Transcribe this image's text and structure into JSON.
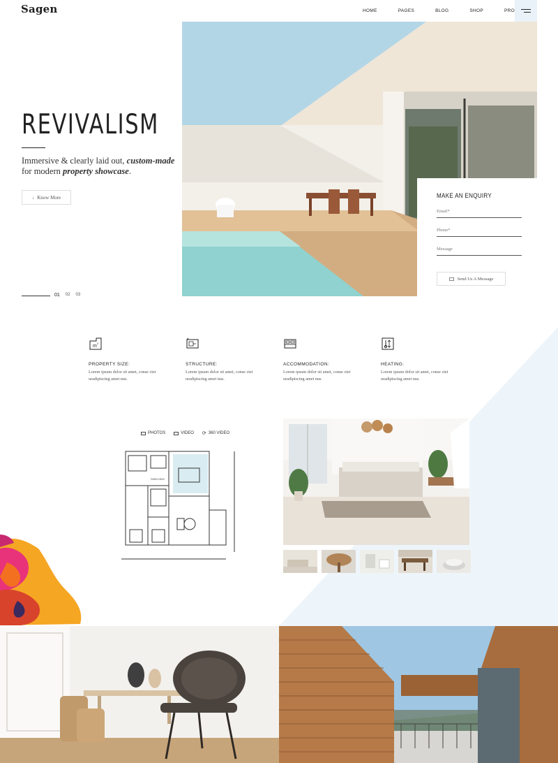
{
  "header": {
    "logo": "Sagen",
    "nav": [
      "HOME",
      "PAGES",
      "BLOG",
      "SHOP",
      "PROPERTY"
    ],
    "menu_icon": "hamburger-icon"
  },
  "hero": {
    "title": "REVIVALISM",
    "subtitle_part1": "Immersive & clearly laid out, ",
    "subtitle_em1": "custom-made",
    "subtitle_part2": " for modern ",
    "subtitle_em2": "property showcase",
    "subtitle_part3": ".",
    "button": "Know More",
    "slides": [
      "01",
      "02",
      "03"
    ],
    "active_slide": "01"
  },
  "enquiry": {
    "title": "MAKE AN ENQUIRY",
    "fields": [
      "Email*",
      "Phone*",
      "Message"
    ],
    "button": "Send Us A Message"
  },
  "features": [
    {
      "title": "PROPERTY SIZE:",
      "text": "Lorem ipsum dolor sit amet, conse ctet uradipiscing amet nus.",
      "icon": "area-m2-icon"
    },
    {
      "title": "STRUCTURE:",
      "text": "Lorem ipsum dolor sit amet, conse ctet uradipiscing amet nus.",
      "icon": "blueprint-icon"
    },
    {
      "title": "ACCOMMODATION:",
      "text": "Lorem ipsum dolor sit amet, conse ctet uradipiscing amet nus.",
      "icon": "bed-icon"
    },
    {
      "title": "HEATING:",
      "text": "Lorem ipsum dolor sit amet, conse ctet uradipiscing amet nus.",
      "icon": "thermometer-icon"
    }
  ],
  "media_tabs": [
    {
      "label": "PHOTOS",
      "icon": "photo-icon"
    },
    {
      "label": "VIDEO",
      "icon": "video-icon"
    },
    {
      "label": "360 VIDEO",
      "icon": "rotate-360-icon"
    }
  ],
  "floor_plan_label": "SHELVING",
  "colors": {
    "accent_light_blue": "#e9f2f8",
    "sky": "#b3d6e6",
    "text_dark": "#222222"
  }
}
